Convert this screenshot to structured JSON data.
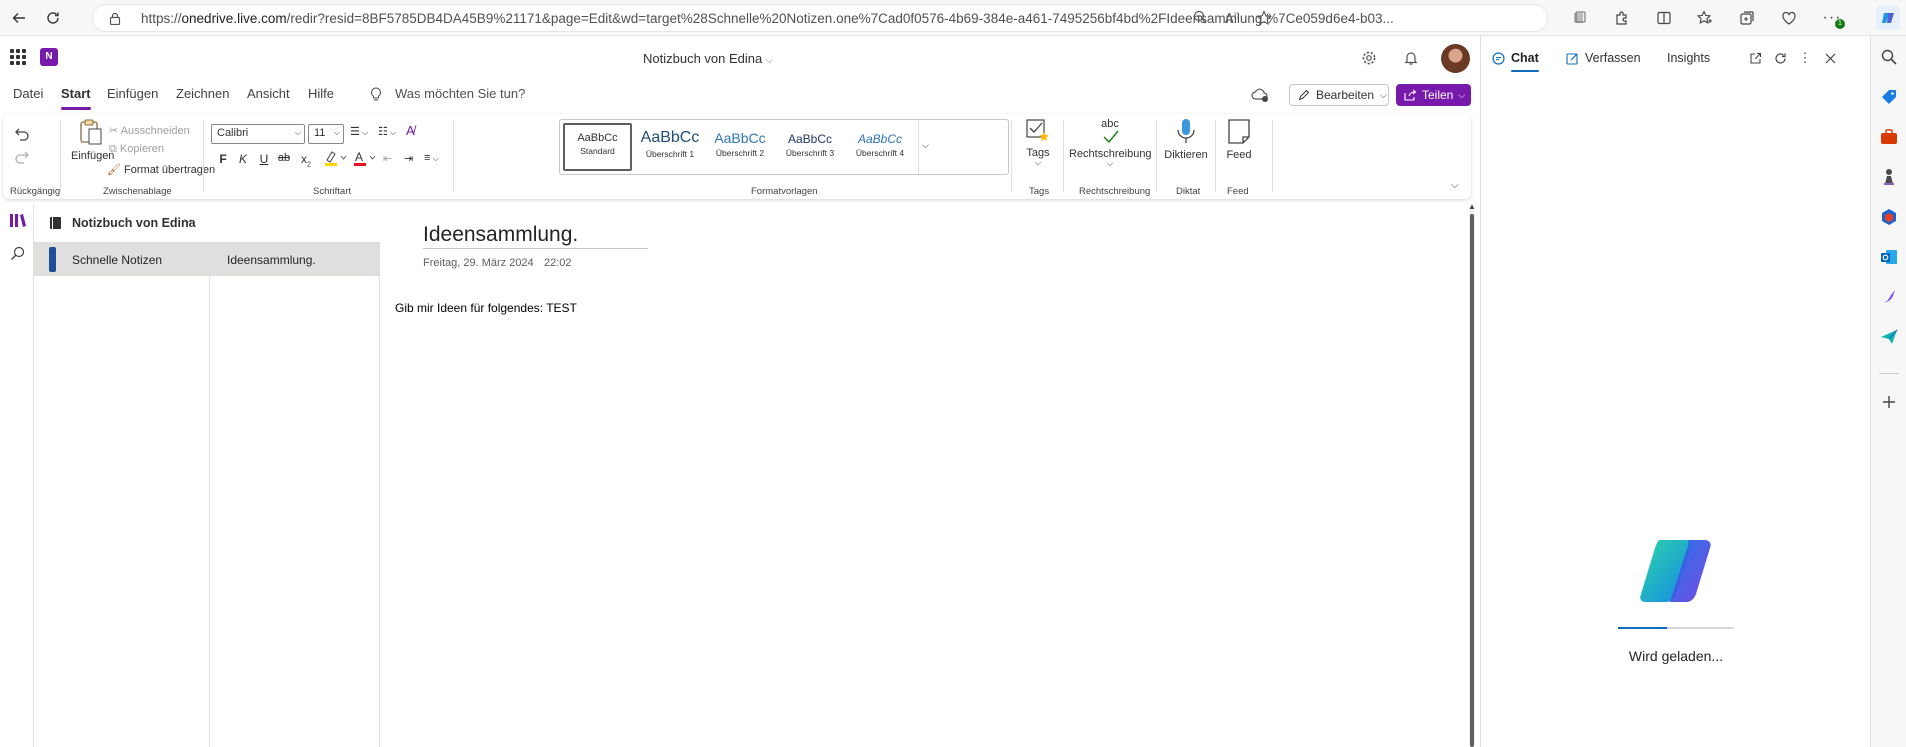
{
  "browser": {
    "url_prefix": "https://",
    "url_host": "onedrive.live.com",
    "url_path": "/redir?resid=8BF5785DB4DA45B9%21171&page=Edit&wd=target%28Schnelle%20Notizen.one%7Cad0f0576-4b69-384e-a461-7495256bf4bd%2FIdeensammlung.%7Ce059d6e4-b03...",
    "ext_badge": "1"
  },
  "header": {
    "notebook_title": "Notizbuch von Edina",
    "app_logo": "N"
  },
  "ribbon_tabs": [
    "Datei",
    "Start",
    "Einfügen",
    "Zeichnen",
    "Ansicht",
    "Hilfe"
  ],
  "tell_me": "Was möchten Sie tun?",
  "edit_button": "Bearbeiten",
  "share_button": "Teilen",
  "ribbon": {
    "undo_group": "Rückgängig",
    "paste": "Einfügen",
    "cut": "Ausschneiden",
    "copy": "Kopieren",
    "format_painter": "Format übertragen",
    "clipboard_group": "Zwischenablage",
    "font_name": "Calibri",
    "font_size": "11",
    "bold": "F",
    "italic": "K",
    "underline": "U",
    "strike": "ab",
    "subscript": "x",
    "font_group": "Schriftart",
    "styles_group": "Formatvorlagen",
    "styles": [
      {
        "preview": "AaBbCc",
        "name": "Standard"
      },
      {
        "preview": "AaBbCc",
        "name": "Überschrift 1"
      },
      {
        "preview": "AaBbCc",
        "name": "Überschrift 2"
      },
      {
        "preview": "AaBbCc",
        "name": "Überschrift 3"
      },
      {
        "preview": "AaBbCc",
        "name": "Überschrift 4"
      }
    ],
    "tags": "Tags",
    "tags_group": "Tags",
    "spelling_abc": "abc",
    "spelling": "Rechtschreibung",
    "spelling_group": "Rechtschreibung",
    "dictate": "Diktieren",
    "dictate_group": "Diktat",
    "feed": "Feed",
    "feed_group": "Feed"
  },
  "navigation": {
    "notebook": "Notizbuch von Edina",
    "section": "Schnelle Notizen",
    "page": "Ideensammlung."
  },
  "page": {
    "title": "Ideensammlung.",
    "date": "Freitag, 29. März 2024",
    "time": "22:02",
    "body": "Gib mir Ideen für folgendes: TEST"
  },
  "copilot": {
    "tabs": [
      "Chat",
      "Verfassen",
      "Insights"
    ],
    "loading_text": "Wird geladen...",
    "progress": 0.42
  },
  "colors": {
    "onenote_purple": "#7719aa",
    "accent_blue": "#0f6cbd"
  }
}
